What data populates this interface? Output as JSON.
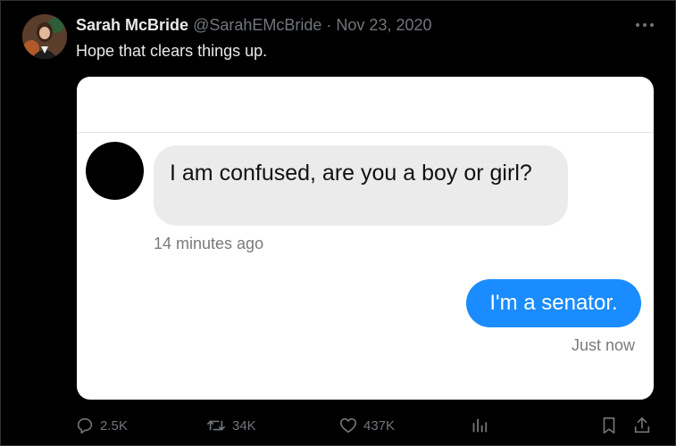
{
  "tweet": {
    "display_name": "Sarah McBride",
    "handle": "@SarahEMcBride",
    "separator": "·",
    "date": "Nov 23, 2020",
    "text": "Hope that clears things up.",
    "more_icon": "more-horizontal-icon"
  },
  "image": {
    "incoming_message": "I am confused, are you a boy or girl?",
    "incoming_time": "14 minutes ago",
    "outgoing_message": "I'm a senator.",
    "outgoing_time": "Just now",
    "outgoing_bubble_color": "#1a8cff",
    "incoming_bubble_color": "#ebebeb"
  },
  "actions": {
    "reply": {
      "icon": "reply-icon",
      "count": "2.5K"
    },
    "retweet": {
      "icon": "retweet-icon",
      "count": "34K"
    },
    "like": {
      "icon": "heart-icon",
      "count": "437K"
    },
    "views": {
      "icon": "analytics-icon"
    },
    "bookmark": {
      "icon": "bookmark-icon"
    },
    "share": {
      "icon": "share-icon"
    }
  },
  "colors": {
    "background": "#000000",
    "primary_text": "#e7e9ea",
    "secondary_text": "#71767b"
  }
}
